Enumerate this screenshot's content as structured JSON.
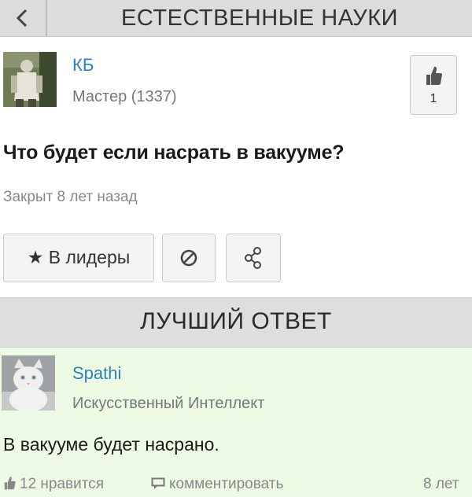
{
  "header": {
    "back_icon": "chevron-left-icon",
    "title": "ЕСТЕСТВЕННЫЕ НАУКИ"
  },
  "question": {
    "author_name": "КБ",
    "author_rank": "Мастер (1337)",
    "like_count": "1",
    "text": "Что будет если насрать в вакууме?",
    "status": "Закрыт 8 лет назад"
  },
  "actions": {
    "leaders_label": "★ В лидеры",
    "block_icon": "block-icon",
    "share_icon": "share-icon"
  },
  "best_answer": {
    "header": "ЛУЧШИЙ ОТВЕТ",
    "author_name": "Spathi",
    "author_rank": "Искусственный Интеллект",
    "text": "В вакууме будет насрано.",
    "likes": "12 нравится",
    "comment_label": "комментировать",
    "time": "8 лет"
  },
  "colors": {
    "header_bg": "#dcdcdc",
    "link_blue": "#2f7fbf",
    "answer_bg": "#eefbe4"
  }
}
